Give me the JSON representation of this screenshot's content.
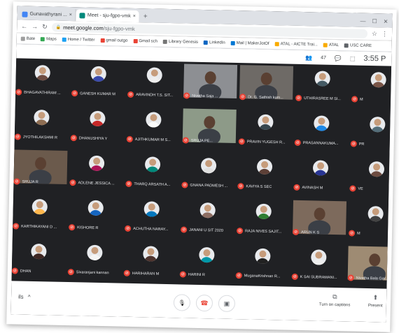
{
  "browser": {
    "tabs": [
      {
        "label": "Gunavathyrani ...",
        "active": false,
        "favicon_color": "#4285f4"
      },
      {
        "label": "Meet - sju-fgpo-vmk",
        "active": true,
        "favicon_color": "#00897b"
      }
    ],
    "new_tab_symbol": "+",
    "window_controls": [
      "—",
      "☐",
      "✕"
    ],
    "url_host": "meet.google.com",
    "url_path": "/sju-fgpo-vmk",
    "bookmarks": [
      {
        "label": "Bate",
        "color": "#9e9e9e"
      },
      {
        "label": "Maps",
        "color": "#34a853"
      },
      {
        "label": "Home / Twitter",
        "color": "#1da1f2"
      },
      {
        "label": "gmail outgo",
        "color": "#ea4335"
      },
      {
        "label": "Gmail sch",
        "color": "#ea4335"
      },
      {
        "label": "Library Genesis",
        "color": "#757575"
      },
      {
        "label": "LinkedIn",
        "color": "#0a66c2"
      },
      {
        "label": "Mail | MakerJotOf",
        "color": "#0078d4"
      },
      {
        "label": "ATAL - AICTE Trai...",
        "color": "#f9ab00"
      },
      {
        "label": "ATAL",
        "color": "#f9ab00"
      },
      {
        "label": "USC CARE",
        "color": "#5f6368"
      }
    ],
    "meet_topbar": {
      "participants_count": "47",
      "clock": "3:55 P"
    }
  },
  "participants": [
    {
      "name": "BHAGAVATHIRAM ...",
      "kind": "avatar",
      "color": "#6d4c41"
    },
    {
      "name": "GANESH KUMAR M",
      "kind": "avatar",
      "color": "#3949ab"
    },
    {
      "name": "ARAVINDH T.S. SIT...",
      "kind": "avatar",
      "color": "#eeeeee"
    },
    {
      "name": "Nivetha Saja ...",
      "kind": "video",
      "color": "#8d8f93"
    },
    {
      "name": "Dr. G. Sathish kum...",
      "kind": "video",
      "color": "#6e6a66"
    },
    {
      "name": "UTHIRASREE M SI...",
      "kind": "avatar",
      "color": "#455a64"
    },
    {
      "name": "M",
      "kind": "avatar",
      "color": "#795548"
    },
    {
      "name": "JYOTHILAKSHMI R",
      "kind": "avatar",
      "color": "#8e6e53"
    },
    {
      "name": "DHANUSHIYA Y",
      "kind": "avatar",
      "color": "#c62828"
    },
    {
      "name": "AJITHKUMAR M S...",
      "kind": "avatar",
      "color": "#fafafa"
    },
    {
      "name": "SRUJA PE...",
      "kind": "video",
      "color": "#8d9a88"
    },
    {
      "name": "PRAVIN YUGESH R...",
      "kind": "avatar",
      "color": "#37474f"
    },
    {
      "name": "PRASANNAKUMA...",
      "kind": "avatar",
      "color": "#1e88e5"
    },
    {
      "name": "PR",
      "kind": "avatar",
      "color": "#546e7a"
    },
    {
      "name": "SRUJA R",
      "kind": "video",
      "color": "#6b5a4c"
    },
    {
      "name": "ADLENE JESSICA ...",
      "kind": "avatar",
      "color": "#ad1457"
    },
    {
      "name": "THARQ ARSATH A...",
      "kind": "avatar",
      "color": "#00897b"
    },
    {
      "name": "GNANA PADMESH ...",
      "kind": "avatar",
      "color": "#e0e0e0"
    },
    {
      "name": "KAVIYA S SEC",
      "kind": "avatar",
      "color": "#5d4037"
    },
    {
      "name": "AVINASH M",
      "kind": "avatar",
      "color": "#283593"
    },
    {
      "name": "VE",
      "kind": "avatar",
      "color": "#6d4c41"
    },
    {
      "name": "KARTHIKAYANI D ...",
      "kind": "avatar",
      "color": "#ffb74d"
    },
    {
      "name": "KISHORE R",
      "kind": "avatar",
      "color": "#1565c0"
    },
    {
      "name": "ACHUTHA NARAY...",
      "kind": "avatar",
      "color": "#0277bd"
    },
    {
      "name": "JANANI U SIT 2020",
      "kind": "avatar",
      "color": "#8d6e63"
    },
    {
      "name": "RAJA NIVES SAJIT...",
      "kind": "avatar",
      "color": "#2e7d32"
    },
    {
      "name": "ARUN K S",
      "kind": "video",
      "color": "#7d6a5c"
    },
    {
      "name": "M",
      "kind": "avatar",
      "color": "#424242"
    },
    {
      "name": "DHAN",
      "kind": "avatar",
      "color": "#3e2723"
    },
    {
      "name": "Sivaranjani kannan",
      "kind": "avatar",
      "color": "#f5f5f5"
    },
    {
      "name": "HARIHARAN M",
      "kind": "avatar",
      "color": "#4e342e"
    },
    {
      "name": "HARINI R",
      "kind": "avatar",
      "color": "#0097a7"
    },
    {
      "name": "MuganaKrishnan R...",
      "kind": "avatar",
      "color": "#212121"
    },
    {
      "name": "K SAI SUBRAMANI...",
      "kind": "avatar",
      "color": "#eeeeee"
    },
    {
      "name": "Nivetha Bala Gar...",
      "kind": "video",
      "color": "#9e8b73"
    }
  ],
  "bottom": {
    "details_label": "ils",
    "details_chevron": "^",
    "mic_symbol": "🎙",
    "hangup_symbol": "☎",
    "camera_symbol": "▣",
    "captions_label": "Turn on captions",
    "present_label": "Present",
    "colors": {
      "hangup": "#ea4335",
      "mic_muted": "#ea4335"
    }
  }
}
